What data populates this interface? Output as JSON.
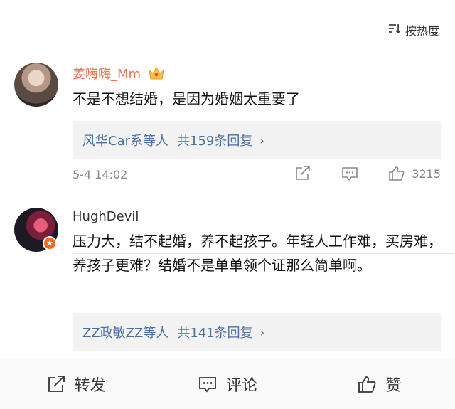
{
  "sort": {
    "label": "按热度",
    "icon": "sort-icon"
  },
  "comments": [
    {
      "username": "姜嗨嗨_Mm",
      "text": "不是不想结婚，是因为婚姻太重要了",
      "replies": {
        "names": "风华Car系等人",
        "count": "共159条回复",
        "chevron": "›"
      },
      "timestamp": "5-4 14:02",
      "likes": "3215",
      "accent": "#eb7350"
    },
    {
      "username": "HughDevil",
      "text": "压力大，结不起婚，养不起孩子。年轻人工作难，买房难，养孩子更难？结婚不是单单领个证那么简单啊。",
      "replies": {
        "names": "ZZ政敏ZZ等人",
        "count": "共141条回复",
        "chevron": "›"
      },
      "badge": "★"
    }
  ],
  "footer": {
    "repost": "转发",
    "comment": "评论",
    "like": "赞"
  },
  "colors": {
    "link": "#4b6fa0",
    "meta": "#888888",
    "badge": "#f26b1d"
  }
}
